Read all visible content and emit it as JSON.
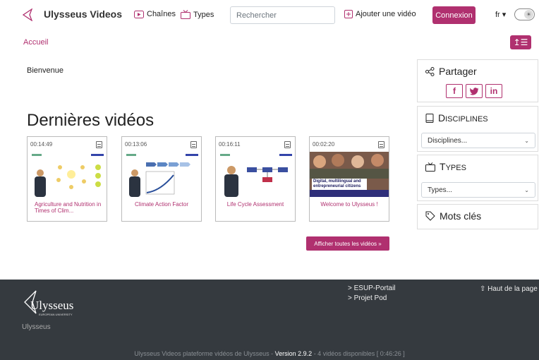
{
  "header": {
    "brand": "Ulysseus Videos",
    "nav_chaines": "Chaînes",
    "nav_types": "Types",
    "search_placeholder": "Rechercher",
    "add_video": "Ajouter une vidéo",
    "login": "Connexion",
    "lang": "fr",
    "menu_symbol": "↥☰"
  },
  "breadcrumb": "Accueil",
  "welcome": "Bienvenue",
  "latest_title": "Dernières vidéos",
  "videos": [
    {
      "duration": "00:14:49",
      "title": "Agriculture and Nutrition in Times of Clim..."
    },
    {
      "duration": "00:13:06",
      "title": "Climate Action Factor"
    },
    {
      "duration": "00:16:11",
      "title": "Life Cycle Assessment"
    },
    {
      "duration": "00:02:20",
      "title": "Welcome to Ulysseus !"
    }
  ],
  "thumb4_text": "Digital, multilingual and entrepreneurial citizens",
  "all_videos": "Afficher toutes les vidéos »",
  "sidebar": {
    "share_title": "Partager",
    "social": [
      "f",
      "t",
      "in"
    ],
    "disciplines_first": "D",
    "disciplines_rest": "ISCIPLINES",
    "disciplines_select": "Disciplines...",
    "types_first": "T",
    "types_rest": "YPES",
    "types_select": "Types...",
    "tags_title": "Mots clés"
  },
  "footer": {
    "logo_text": "Ulysseus",
    "logo_sub": "EUROPEAN UNIVERSITY",
    "link1": "> ESUP-Portail",
    "link2": "> Projet Pod",
    "top": "⇧ Haut de la page",
    "site": "Ulysseus",
    "bottom_prefix": "Ulysseus Videos plateforme vidéos de Ulysseus - ",
    "bottom_version": "Version 2.9.2",
    "bottom_suffix": " - 4 vidéos disponibles [ 0:46:26 ]"
  },
  "colors": {
    "accent": "#b0306f",
    "footer_bg": "#353a3f"
  }
}
